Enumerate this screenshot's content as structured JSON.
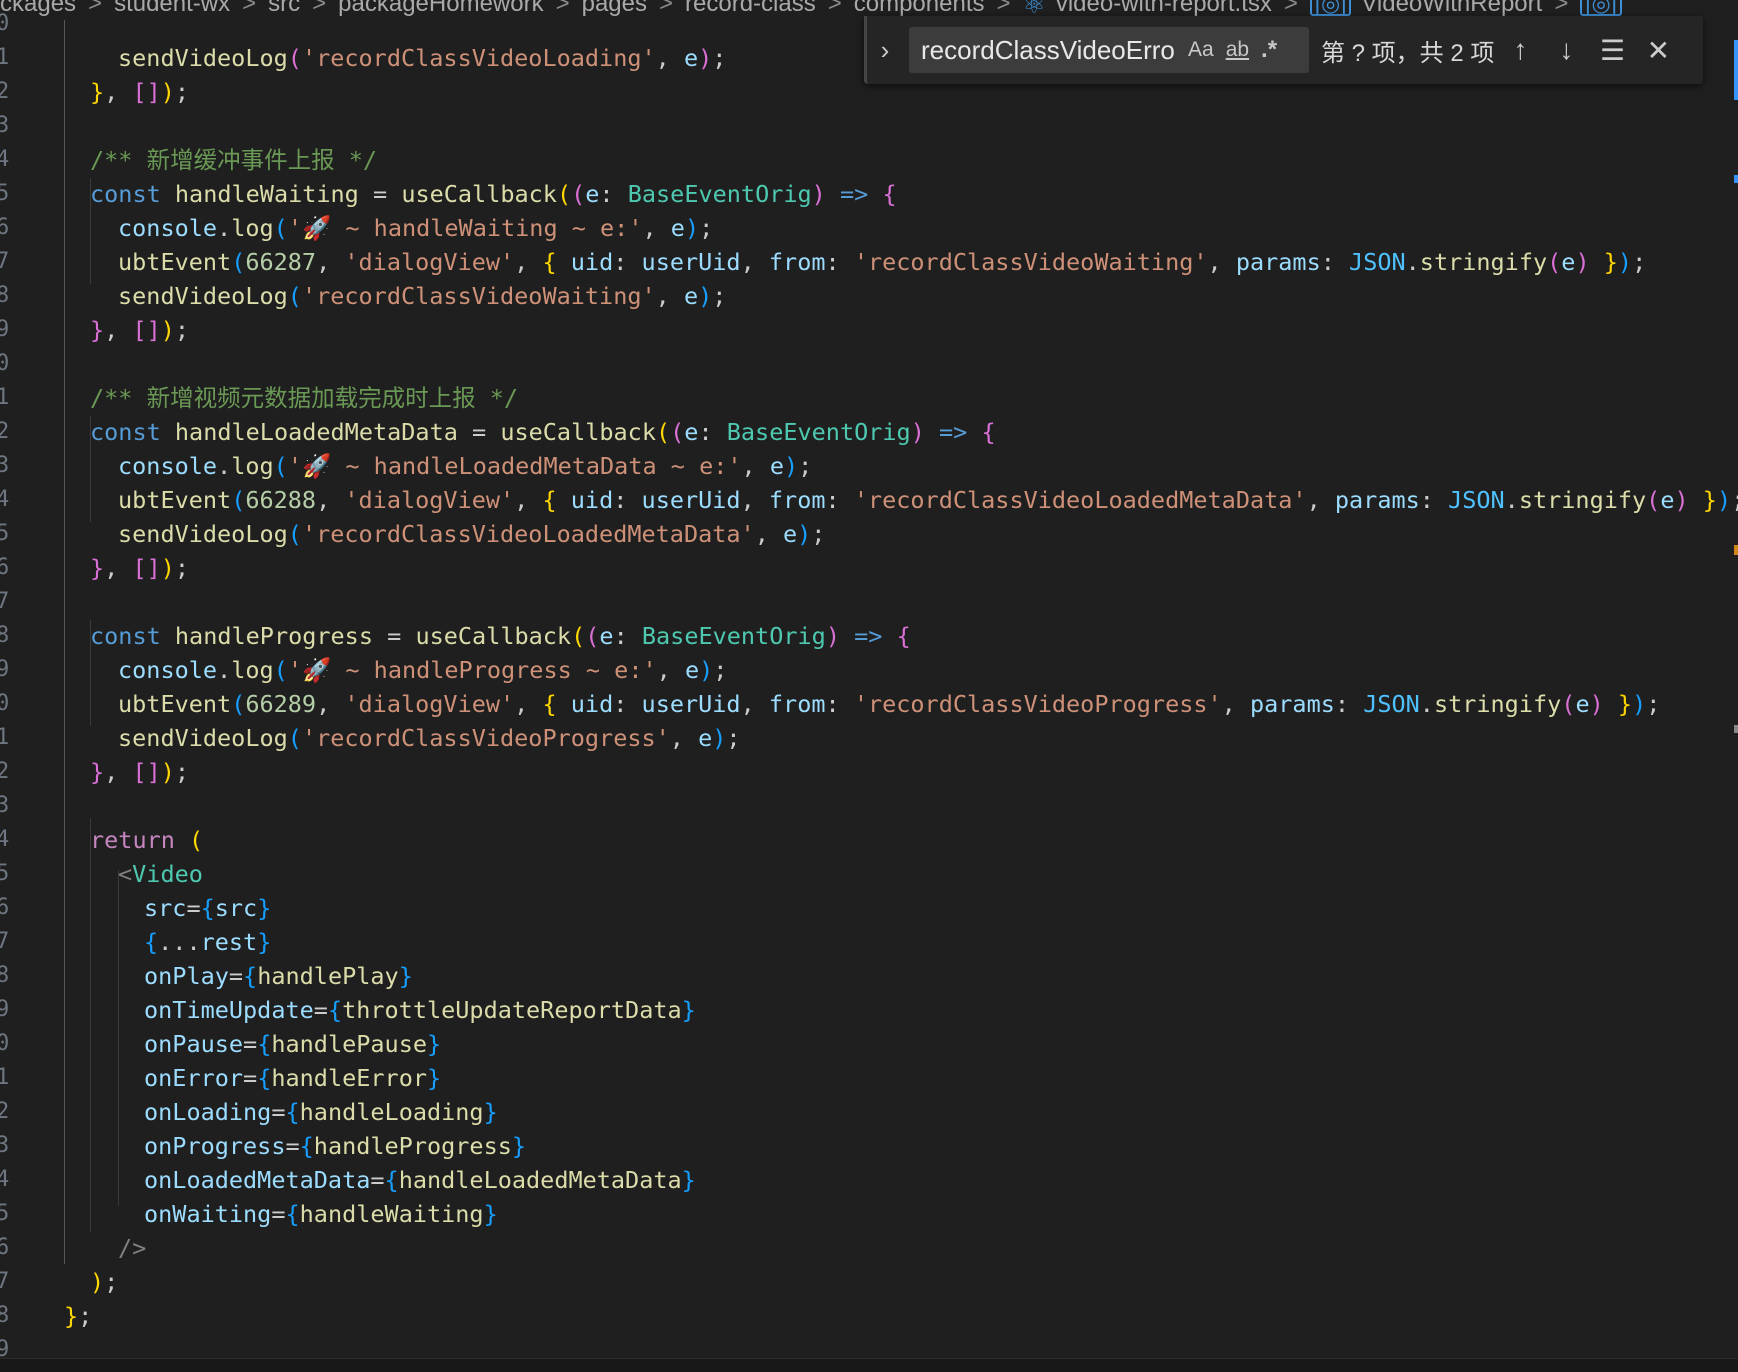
{
  "breadcrumb": {
    "items": [
      "ckages",
      "student-wx",
      "src",
      "packageHomework",
      "pages",
      "record-class",
      "components"
    ],
    "file": "video-with-report.tsx",
    "symbol": "VideoWithReport",
    "separator": ">"
  },
  "find_widget": {
    "query": "recordClassVideoError",
    "match_case_label": "Aa",
    "whole_word_label": "ab",
    "regex_label": ".*",
    "result_text": "第 ? 项，共 2 项"
  },
  "line_numbers": [
    "0",
    "1",
    "2",
    "3",
    "4",
    "5",
    "6",
    "7",
    "8",
    "9",
    "0",
    "1",
    "2",
    "3",
    "4",
    "5",
    "6",
    "7",
    "8",
    "9",
    "0",
    "1",
    "2",
    "3",
    "4",
    "5",
    "6",
    "7",
    "8",
    "9",
    "0",
    "1",
    "2",
    "3",
    "4",
    "5",
    "6",
    "7",
    "8",
    "9"
  ],
  "code": {
    "l0": "sendVideoLog('recordClassVideoLoading', e);",
    "comment1": "/** 新增缓冲事件上报 */",
    "comment2": "/** 新增视频元数据加载完成时上报 */",
    "waiting_log": "'🚀 ~ handleWaiting ~ e:'",
    "meta_log": "'🚀 ~ handleLoadedMetaData ~ e:'",
    "progress_log": "'🚀 ~ handleProgress ~ e:'",
    "waiting_str": "'recordClassVideoWaiting'",
    "meta_str": "'recordClassVideoLoadedMetaData'",
    "progress_str": "'recordClassVideoProgress'",
    "dialog_str": "'dialogView'",
    "n66287": "66287",
    "n66288": "66288",
    "n66289": "66289"
  }
}
